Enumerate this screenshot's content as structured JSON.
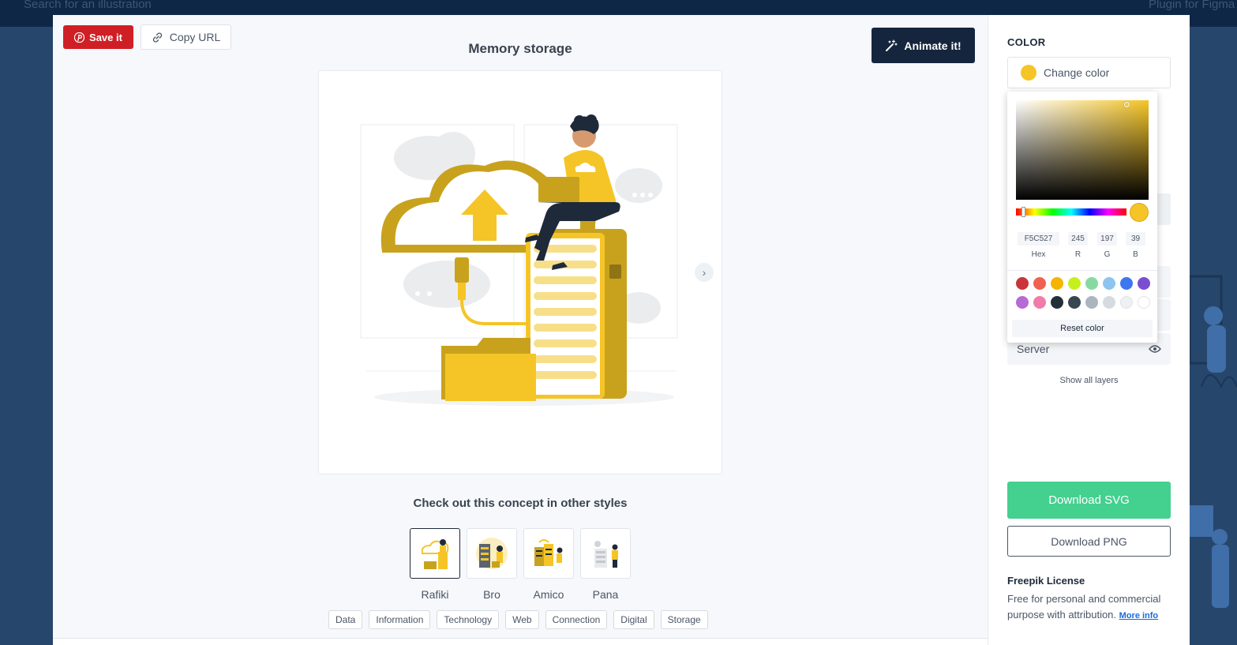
{
  "background": {
    "search_text": "Search for an illustration",
    "plugin_text": "Plugin for Figma"
  },
  "toolbar": {
    "save_label": "Save it",
    "copy_url_label": "Copy URL",
    "animate_label": "Animate it!"
  },
  "illustration": {
    "title": "Memory storage"
  },
  "concept": {
    "heading": "Check out this concept in other styles",
    "styles": [
      {
        "label": "Rafiki",
        "active": true
      },
      {
        "label": "Bro",
        "active": false
      },
      {
        "label": "Amico",
        "active": false
      },
      {
        "label": "Pana",
        "active": false
      }
    ]
  },
  "tags": [
    "Data",
    "Information",
    "Technology",
    "Web",
    "Connection",
    "Digital",
    "Storage"
  ],
  "sidebar": {
    "color_heading": "COLOR",
    "change_color_label": "Change color",
    "current_color": "#f5c527",
    "layer_server_label": "Server",
    "show_all_layers": "Show all layers",
    "download_svg": "Download SVG",
    "download_png": "Download PNG",
    "license_title": "Freepik License",
    "license_text": "Free for personal and commercial purpose with attribution.",
    "more_info": "More info"
  },
  "color_picker": {
    "hex": "F5C527",
    "r": "245",
    "g": "197",
    "b": "39",
    "labels": {
      "hex": "Hex",
      "r": "R",
      "g": "G",
      "b": "B"
    },
    "swatches": [
      "#c9353a",
      "#f06250",
      "#f5b400",
      "#c6f01d",
      "#87d9a2",
      "#8ec5f0",
      "#3d76f0",
      "#7b4ed1",
      "#b66ad6",
      "#f27bab",
      "#243038",
      "#37474f",
      "#aab5bd",
      "#d5dbe1",
      "#eef0f2",
      "#ffffff"
    ],
    "reset_label": "Reset color"
  }
}
